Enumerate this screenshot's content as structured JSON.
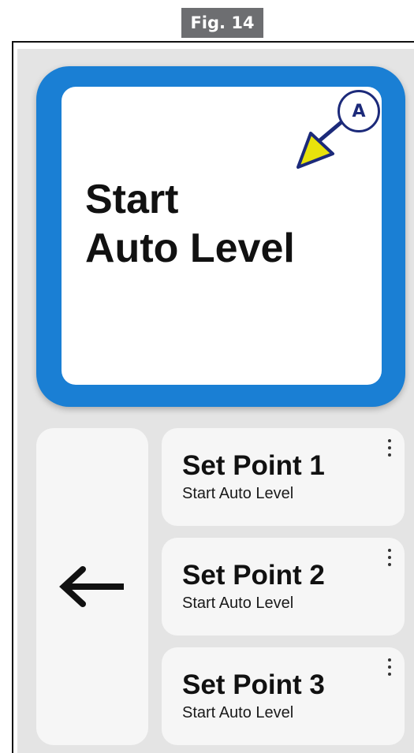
{
  "figure": {
    "label": "Fig. 14"
  },
  "auto_level": {
    "line1": "Start",
    "line2": "Auto Level"
  },
  "callout": {
    "label": "A"
  },
  "back": {
    "icon": "arrow-left-icon"
  },
  "set_points": [
    {
      "title": "Set Point 1",
      "subtitle": "Start Auto Level"
    },
    {
      "title": "Set Point 2",
      "subtitle": "Start Auto Level"
    },
    {
      "title": "Set Point 3",
      "subtitle": "Start Auto Level"
    }
  ],
  "colors": {
    "accent": "#1a7fd4",
    "callout_border": "#1c2a7a",
    "callout_arrow": "#e8e20c",
    "figure_label_bg": "#6d6e71",
    "screen_bg": "#e4e4e4",
    "card_bg": "#f6f6f6"
  }
}
